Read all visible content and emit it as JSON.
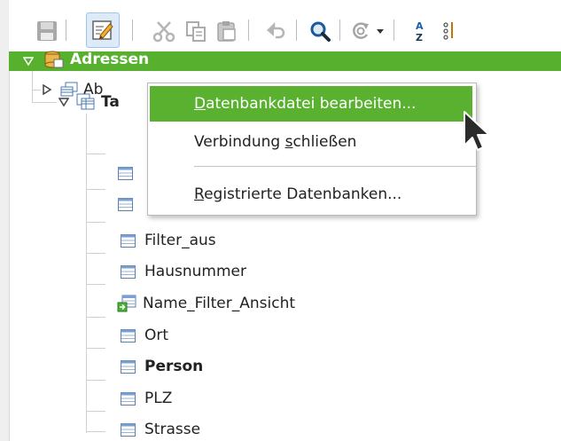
{
  "toolbar": {
    "buttons": [
      {
        "name": "save-icon"
      },
      {
        "name": "edit-icon"
      },
      {
        "name": "cut-icon"
      },
      {
        "name": "copy-icon"
      },
      {
        "name": "paste-icon"
      },
      {
        "name": "undo-icon"
      },
      {
        "name": "find-icon"
      },
      {
        "name": "refresh-icon"
      },
      {
        "name": "dropdown-arrow-icon"
      },
      {
        "name": "sort-ascending-icon"
      },
      {
        "name": "sort-descending-icon"
      }
    ]
  },
  "tree": {
    "root_label": "Adressen",
    "queries_label": "Ab",
    "tables_label": "Ta",
    "tables": [
      {
        "label": "Filter_aus",
        "bold": false,
        "type": "table"
      },
      {
        "label": "Hausnummer",
        "bold": false,
        "type": "table"
      },
      {
        "label": "Name_Filter_Ansicht",
        "bold": false,
        "type": "view"
      },
      {
        "label": "Ort",
        "bold": false,
        "type": "table"
      },
      {
        "label": "Person",
        "bold": true,
        "type": "table"
      },
      {
        "label": "PLZ",
        "bold": false,
        "type": "table"
      },
      {
        "label": "Strasse",
        "bold": false,
        "type": "table"
      }
    ]
  },
  "context_menu": {
    "items": [
      {
        "pre": "",
        "mn": "D",
        "post": "atenbankdatei bearbeiten...",
        "highlighted": true
      },
      {
        "pre": "Verbindung ",
        "mn": "s",
        "post": "chließen",
        "highlighted": false
      },
      {
        "pre": "",
        "mn": "R",
        "post": "egistrierte Datenbanken...",
        "highlighted": false
      }
    ]
  },
  "colors": {
    "selection_green": "#58b02f",
    "menu_highlight": "#5ab12f",
    "active_button_bg": "#dcebf7"
  }
}
